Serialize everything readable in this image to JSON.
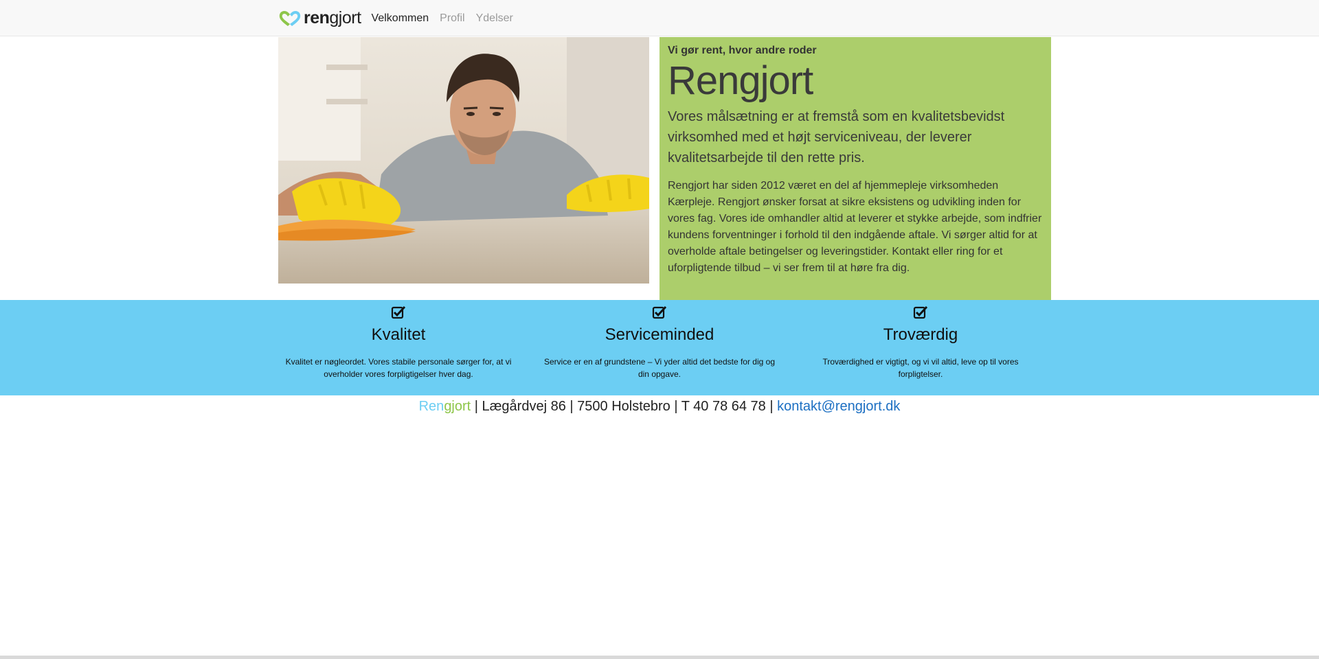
{
  "nav": {
    "brand_ren": "ren",
    "brand_gjort": "gjort",
    "links": [
      {
        "label": "Velkommen",
        "active": true
      },
      {
        "label": "Profil",
        "active": false
      },
      {
        "label": "Ydelser",
        "active": false
      }
    ]
  },
  "hero": {
    "tagline": "Vi gør rent, hvor andre roder",
    "title": "Rengjort",
    "lead": "Vores målsætning er at fremstå som en kvalitetsbevidst virksomhed med et højt  serviceniveau, der leverer kvalitetsarbejde til den rette pris.",
    "body": "Rengjort har siden 2012 været en del af hjemmepleje virksomheden Kærpleje. Rengjort ønsker forsat at sikre eksistens og udvikling inden for vores fag. Vores ide omhandler altid at leverer et stykke arbejde, som indfrier kundens forventninger i forhold til den indgående aftale. Vi sørger altid for at overholde aftale betingelser og leveringstider. Kontakt eller ring for et uforpligtende tilbud – vi ser frem til at høre fra dig."
  },
  "features": [
    {
      "icon": "checkbox-icon",
      "title": "Kvalitet",
      "text": "Kvalitet er nøgleordet. Vores stabile personale sørger for, at vi overholder vores forpligtigelser hver dag."
    },
    {
      "icon": "checkbox-icon",
      "title": "Serviceminded",
      "text": "Service er en af grundstene – Vi yder altid det bedste for dig og din opgave."
    },
    {
      "icon": "checkbox-icon",
      "title": "Troværdig",
      "text": "Troværdighed er vigtigt, og vi vil altid, leve op til vores forpligtelser."
    }
  ],
  "footer": {
    "brand_part1": "Ren",
    "brand_part2": "gjort",
    "address": " | Lægårdvej 86 | 7500 Holstebro | T 40 78 64 78 | ",
    "email": "kontakt@rengjort.dk"
  },
  "colors": {
    "green": "#acce6b",
    "blue": "#6ccef3",
    "link": "#1c6fc2"
  }
}
